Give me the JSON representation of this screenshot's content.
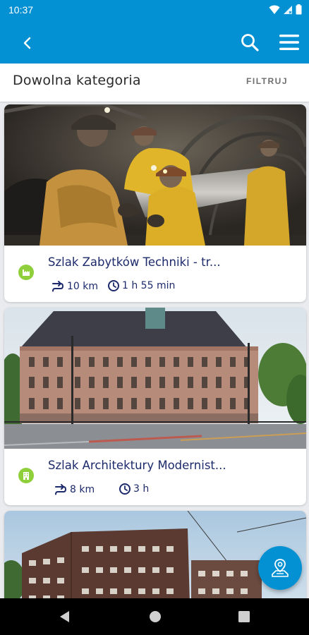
{
  "status_bar": {
    "time": "10:37"
  },
  "filter": {
    "category": "Dowolna kategoria",
    "button": "FILTRUJ"
  },
  "routes": [
    {
      "title": "Szlak Zabytków Techniki - tr...",
      "distance": "10 km",
      "duration": "1 h 55 min",
      "category_icon": "industry-icon"
    },
    {
      "title": "Szlak Architektury Modernist...",
      "distance": "8 km",
      "duration": "3 h",
      "category_icon": "building-icon"
    }
  ],
  "colors": {
    "primary": "#0391d4",
    "category_green": "#8fcf3c",
    "title_text": "#1d2a6b"
  }
}
